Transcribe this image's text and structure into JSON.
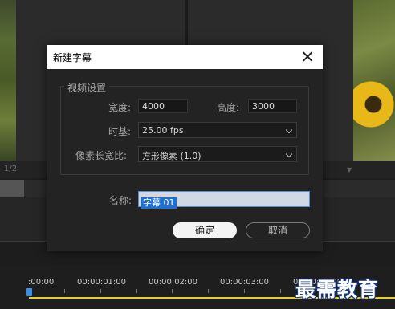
{
  "background": {
    "monitor_fraction": "1/2",
    "timeline": {
      "timecodes": [
        ":00:00",
        "00:00:01:00",
        "00:00:02:00",
        "00:00:03:00",
        "00:00:04:00"
      ]
    }
  },
  "dialog": {
    "title": "新建字幕",
    "video_settings": {
      "legend": "视频设置",
      "width_label": "宽度:",
      "width_value": "4000",
      "height_label": "高度:",
      "height_value": "3000",
      "timebase_label": "时基:",
      "timebase_value": "25.00 fps",
      "pixel_aspect_label": "像素长宽比:",
      "pixel_aspect_value": "方形像素 (1.0)"
    },
    "name_label": "名称:",
    "name_value": "字幕 01",
    "ok_label": "确定",
    "cancel_label": "取消"
  },
  "watermark": "最需教育",
  "colors": {
    "accent_blue": "#1e6fd4",
    "playhead": "#3a8ee6",
    "work_area_bar": "#e8d21e",
    "dialog_bg": "#232323"
  }
}
